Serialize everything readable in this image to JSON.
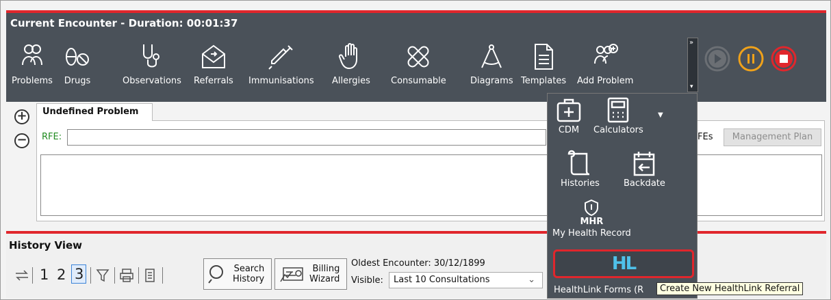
{
  "encounter": {
    "title": "Current Encounter - Duration: 00:01:37",
    "toolbar": [
      {
        "label": "Problems",
        "icon": "problems-icon"
      },
      {
        "label": "Drugs",
        "icon": "drugs-icon"
      },
      {
        "label": "Observations",
        "icon": "stethoscope-icon"
      },
      {
        "label": "Referrals",
        "icon": "referral-envelope-icon"
      },
      {
        "label": "Immunisations",
        "icon": "syringe-icon"
      },
      {
        "label": "Allergies",
        "icon": "hand-icon"
      },
      {
        "label": "Consumable",
        "icon": "bandage-icon"
      },
      {
        "label": "Diagrams",
        "icon": "compass-icon"
      },
      {
        "label": "Templates",
        "icon": "document-icon"
      },
      {
        "label": "Add Problem",
        "icon": "add-problem-icon"
      }
    ],
    "controls": {
      "play_color": "#6b6f74",
      "pause_color": "#f0a21a",
      "stop_color": "#e0262c"
    }
  },
  "problem": {
    "tab_label": "Undefined Problem",
    "rfe_label": "RFE:",
    "rfe_value": "",
    "rfes_label": "FEs",
    "management_plan": "Management Plan"
  },
  "history": {
    "title": "History View",
    "page_numbers": [
      "1",
      "2",
      "3"
    ],
    "selected_page": "3",
    "search_history": [
      "Search",
      "History"
    ],
    "billing_wizard": [
      "Billing",
      "Wizard"
    ],
    "oldest_encounter": "Oldest Encounter: 30/12/1899",
    "visible_label": "Visible:",
    "visible_value": "Last 10 Consultations"
  },
  "dropdown": {
    "items": [
      {
        "label": "CDM",
        "icon": "medical-kit-icon"
      },
      {
        "label": "Calculators",
        "icon": "calculator-icon"
      },
      {
        "label": "Histories",
        "icon": "scroll-icon"
      },
      {
        "label": "Backdate",
        "icon": "calendar-back-icon"
      },
      {
        "label": "My Health Record",
        "icon": "mhr-shield-icon",
        "sub": "MHR"
      },
      {
        "label": "HealthLink Forms (R",
        "icon": "healthlink-logo"
      }
    ],
    "hl_logo_text": "HL"
  },
  "tooltip": "Create New HealthLink Referral"
}
